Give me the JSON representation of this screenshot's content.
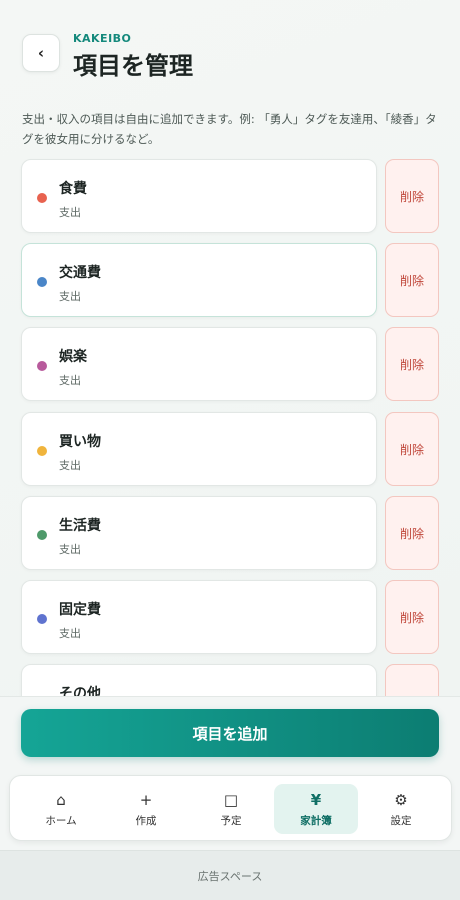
{
  "header": {
    "back_icon": "‹",
    "brand": "KAKEIBO",
    "title": "項目を管理"
  },
  "description": "支出・収入の項目は自由に追加できます。例: 「勇人」タグを友達用、「綾香」タグを彼女用に分けるなど。",
  "items": [
    {
      "name": "食費",
      "type": "支出",
      "color": "#e8624f",
      "delete_label": "削除"
    },
    {
      "name": "交通費",
      "type": "支出",
      "color": "#4a86c8",
      "delete_label": "削除"
    },
    {
      "name": "娯楽",
      "type": "支出",
      "color": "#b85a9c",
      "delete_label": "削除"
    },
    {
      "name": "買い物",
      "type": "支出",
      "color": "#f0b43c",
      "delete_label": "削除"
    },
    {
      "name": "生活費",
      "type": "支出",
      "color": "#4e9a6a",
      "delete_label": "削除"
    },
    {
      "name": "固定費",
      "type": "支出",
      "color": "#5f73cf",
      "delete_label": "削除"
    },
    {
      "name": "その他",
      "type": "",
      "color": "#9aa3a0",
      "delete_label": ""
    }
  ],
  "add_button_label": "項目を追加",
  "tabs": [
    {
      "icon": "⌂",
      "icon_name": "home-icon",
      "label": "ホーム"
    },
    {
      "icon": "+",
      "icon_name": "plus-icon",
      "label": "作成"
    },
    {
      "icon": "□",
      "icon_name": "calendar-icon",
      "label": "予定"
    },
    {
      "icon": "¥",
      "icon_name": "yen-icon",
      "label": "家計簿"
    },
    {
      "icon": "⚙",
      "icon_name": "gear-icon",
      "label": "設定"
    }
  ],
  "active_tab": "家計簿",
  "ad_label": "広告スペース",
  "colors": {
    "accent": "#14897c",
    "delete_bg": "#fff1ef",
    "delete_text": "#c0473a"
  }
}
